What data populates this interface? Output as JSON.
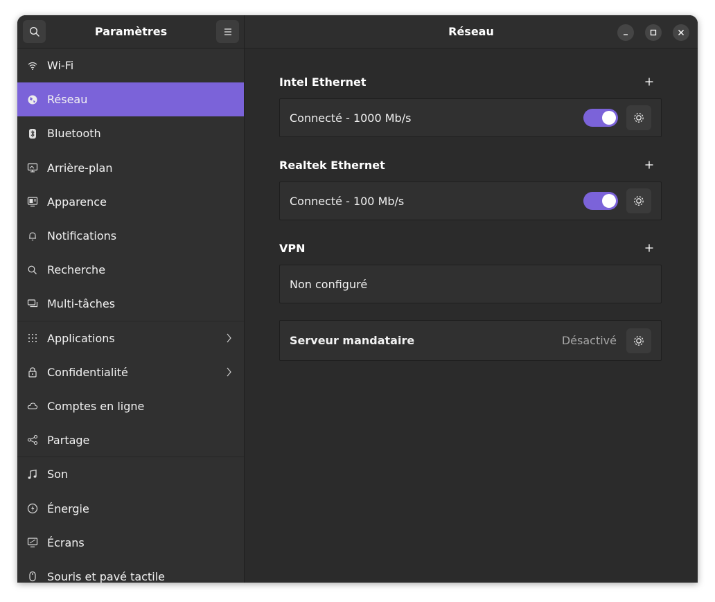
{
  "sidebar": {
    "title": "Paramètres",
    "items": [
      {
        "label": "Wi-Fi",
        "icon": "wifi-icon"
      },
      {
        "label": "Réseau",
        "icon": "network-globe-icon",
        "active": true
      },
      {
        "label": "Bluetooth",
        "icon": "bluetooth-icon"
      },
      {
        "label": "Arrière-plan",
        "icon": "background-icon"
      },
      {
        "label": "Apparence",
        "icon": "appearance-icon"
      },
      {
        "label": "Notifications",
        "icon": "bell-icon"
      },
      {
        "label": "Recherche",
        "icon": "search-icon"
      },
      {
        "label": "Multi-tâches",
        "icon": "multitasking-icon"
      },
      {
        "label": "Applications",
        "icon": "apps-grid-icon"
      },
      {
        "label": "Confidentialité",
        "icon": "lock-icon"
      },
      {
        "label": "Comptes en ligne",
        "icon": "cloud-icon"
      },
      {
        "label": "Partage",
        "icon": "share-icon"
      },
      {
        "label": "Son",
        "icon": "music-note-icon"
      },
      {
        "label": "Énergie",
        "icon": "power-icon"
      },
      {
        "label": "Écrans",
        "icon": "display-icon"
      },
      {
        "label": "Souris et pavé tactile",
        "icon": "mouse-icon"
      }
    ]
  },
  "main": {
    "title": "Réseau",
    "groups": [
      {
        "title": "Intel Ethernet",
        "status": "Connecté - 1000 Mb/s",
        "enabled": true
      },
      {
        "title": "Realtek Ethernet",
        "status": "Connecté - 100 Mb/s",
        "enabled": true
      },
      {
        "title": "VPN",
        "status": "Non configuré"
      }
    ],
    "proxy": {
      "label": "Serveur mandataire",
      "status": "Désactivé"
    }
  },
  "colors": {
    "accent": "#7b63d9",
    "window_bg": "#2b2b2b",
    "sidebar_bg": "#303030"
  }
}
